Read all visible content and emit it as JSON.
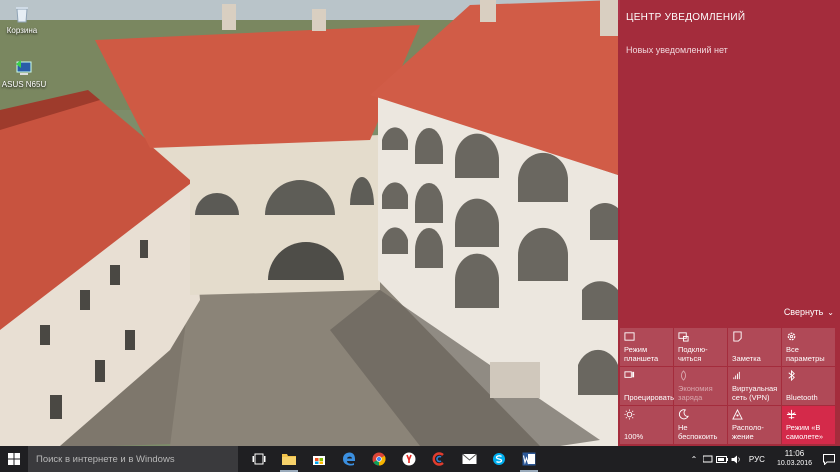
{
  "desktop": {
    "icons": [
      {
        "label": "Корзина"
      },
      {
        "label": "ASUS N65U"
      }
    ]
  },
  "action_center": {
    "title": "ЦЕНТР УВЕДОМЛЕНИЙ",
    "empty_text": "Новых уведомлений нет",
    "collapse_label": "Свернуть",
    "tiles": [
      {
        "label": "Режим планшета",
        "icon": "tablet-mode-icon",
        "state": "normal"
      },
      {
        "label": "Подклю-читься",
        "icon": "connect-icon",
        "state": "normal"
      },
      {
        "label": "Заметка",
        "icon": "note-icon",
        "state": "normal"
      },
      {
        "label": "Все параметры",
        "icon": "gear-icon",
        "state": "normal"
      },
      {
        "label": "Проецировать",
        "icon": "project-icon",
        "state": "normal"
      },
      {
        "label": "Экономия заряда",
        "icon": "battery-saver-icon",
        "state": "disabled"
      },
      {
        "label": "Виртуальная сеть (VPN)",
        "icon": "vpn-icon",
        "state": "normal"
      },
      {
        "label": "Bluetooth",
        "icon": "bluetooth-icon",
        "state": "normal"
      },
      {
        "label": "100%",
        "icon": "brightness-icon",
        "state": "normal"
      },
      {
        "label": "Не беспокоить",
        "icon": "quiet-hours-icon",
        "state": "normal"
      },
      {
        "label": "Располо-жение",
        "icon": "location-icon",
        "state": "normal"
      },
      {
        "label": "Режим «В самолете»",
        "icon": "airplane-icon",
        "state": "active"
      }
    ]
  },
  "taskbar": {
    "search_placeholder": "Поиск в интернете и в Windows",
    "apps": [
      {
        "name": "task-view",
        "icon": "task-view-icon"
      },
      {
        "name": "file-explorer",
        "icon": "folder-icon"
      },
      {
        "name": "store",
        "icon": "store-icon"
      },
      {
        "name": "edge",
        "icon": "edge-icon"
      },
      {
        "name": "chrome",
        "icon": "chrome-icon"
      },
      {
        "name": "yandex",
        "icon": "yandex-icon"
      },
      {
        "name": "ccleaner",
        "icon": "ccleaner-icon"
      },
      {
        "name": "mail",
        "icon": "mail-icon"
      },
      {
        "name": "skype",
        "icon": "skype-icon"
      },
      {
        "name": "word",
        "icon": "word-icon"
      }
    ],
    "tray": {
      "language": "РУС",
      "time": "11:06",
      "date": "10.03.2016"
    }
  },
  "colors": {
    "action_center_bg": "#aa1c34",
    "active_tile": "#d42a4a",
    "taskbar_bg": "#1f1f22"
  }
}
